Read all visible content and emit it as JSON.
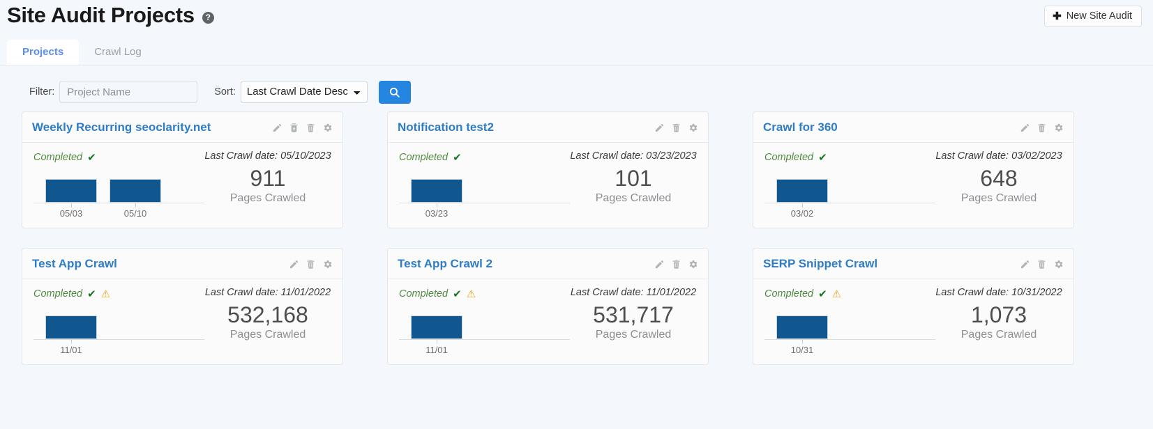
{
  "header": {
    "title": "Site Audit Projects",
    "help_icon": "help-circle-icon",
    "new_audit_label": "New Site Audit",
    "plus_glyph": "✚"
  },
  "tabs": [
    {
      "label": "Projects",
      "active": true
    },
    {
      "label": "Crawl Log",
      "active": false
    }
  ],
  "filter_bar": {
    "filter_label": "Filter:",
    "filter_placeholder": "Project Name",
    "filter_value": "",
    "sort_label": "Sort:",
    "sort_selected": "Last Crawl Date Desc",
    "sort_options": [
      "Last Crawl Date Desc"
    ],
    "search_icon": "search-icon"
  },
  "labels": {
    "pages_crawled": "Pages Crawled",
    "check_glyph": "✔",
    "warn_glyph": "⚠"
  },
  "colors": {
    "accent_blue": "#2486e0",
    "bar_blue": "#11578f",
    "title_blue": "#2f7dc7",
    "status_green": "#4e8c3f",
    "warn_orange": "#f0a415",
    "page_bg": "#f4f7fc"
  },
  "cards": [
    {
      "title": "Weekly Recurring seoclarity.net",
      "status": "Completed",
      "has_warning": false,
      "crawl_date": "Last Crawl date: 05/10/2023",
      "pages": "911",
      "actions": [
        "edit-icon",
        "crawl-now-icon",
        "delete-icon",
        "settings-icon"
      ],
      "bars": [
        {
          "label": "05/03",
          "value": 100
        },
        {
          "label": "05/10",
          "value": 100
        }
      ]
    },
    {
      "title": "Notification test2",
      "status": "Completed",
      "has_warning": false,
      "crawl_date": "Last Crawl date: 03/23/2023",
      "pages": "101",
      "actions": [
        "edit-icon",
        "delete-icon",
        "settings-icon"
      ],
      "bars": [
        {
          "label": "03/23",
          "value": 100
        }
      ]
    },
    {
      "title": "Crawl for 360",
      "status": "Completed",
      "has_warning": false,
      "crawl_date": "Last Crawl date: 03/02/2023",
      "pages": "648",
      "actions": [
        "edit-icon",
        "delete-icon",
        "settings-icon"
      ],
      "bars": [
        {
          "label": "03/02",
          "value": 100
        }
      ]
    },
    {
      "title": "Test App Crawl",
      "status": "Completed",
      "has_warning": true,
      "crawl_date": "Last Crawl date: 11/01/2022",
      "pages": "532,168",
      "actions": [
        "edit-icon",
        "delete-icon",
        "settings-icon"
      ],
      "bars": [
        {
          "label": "11/01",
          "value": 100
        }
      ]
    },
    {
      "title": "Test App Crawl 2",
      "status": "Completed",
      "has_warning": true,
      "crawl_date": "Last Crawl date: 11/01/2022",
      "pages": "531,717",
      "actions": [
        "edit-icon",
        "delete-icon",
        "settings-icon"
      ],
      "bars": [
        {
          "label": "11/01",
          "value": 100
        }
      ]
    },
    {
      "title": "SERP Snippet Crawl",
      "status": "Completed",
      "has_warning": true,
      "crawl_date": "Last Crawl date: 10/31/2022",
      "pages": "1,073",
      "actions": [
        "edit-icon",
        "delete-icon",
        "settings-icon"
      ],
      "bars": [
        {
          "label": "10/31",
          "value": 100
        }
      ]
    }
  ]
}
